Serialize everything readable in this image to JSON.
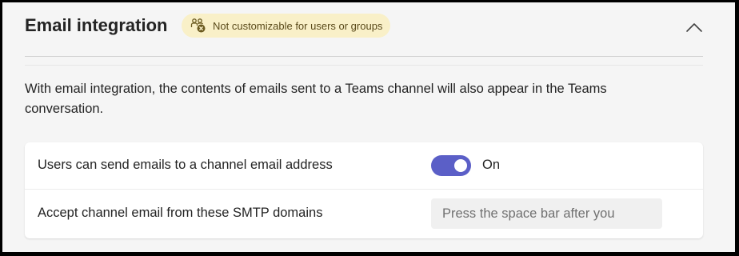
{
  "section": {
    "title": "Email integration",
    "badge_text": "Not customizable for users or groups",
    "badge_icon": "users-blocked-icon",
    "collapse_icon": "chevron-up-icon"
  },
  "description": "With email integration, the contents of emails sent to a Teams channel will also appear in the Teams conversation.",
  "settings": {
    "send_emails": {
      "label": "Users can send emails to a channel email address",
      "state": "On",
      "enabled": true
    },
    "smtp_domains": {
      "label": "Accept channel email from these SMTP domains",
      "value": "",
      "placeholder": "Press the space bar after you"
    }
  },
  "colors": {
    "accent": "#5b5fc7",
    "badge_bg": "#f9f0c8"
  }
}
